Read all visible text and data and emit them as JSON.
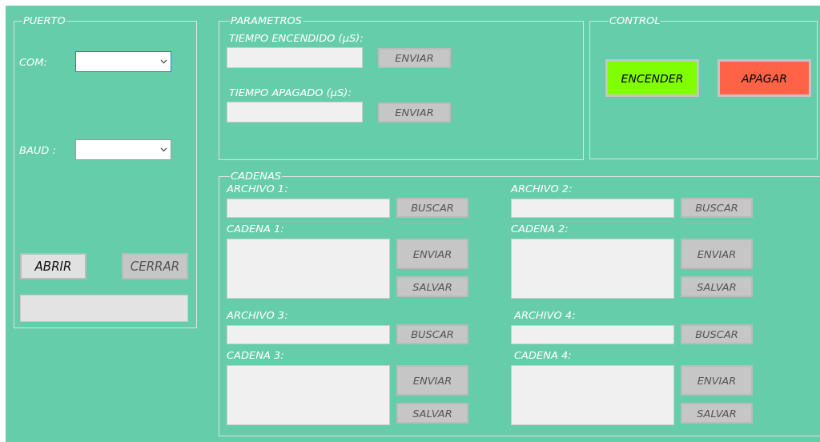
{
  "puerto": {
    "title": "PUERTO",
    "fields": [
      {
        "label": "COM:",
        "focused": true
      },
      {
        "label": "BAUD :",
        "focused": false
      }
    ],
    "buttons": [
      {
        "label": "ABRIR",
        "disabled": false
      },
      {
        "label": "CERRAR",
        "disabled": true
      }
    ]
  },
  "parametros": {
    "title": "PARAMETROS",
    "rows": [
      {
        "label": "TIEMPO ENCENDIDO (µS):",
        "button": {
          "label": "ENVIAR",
          "disabled": true
        }
      },
      {
        "label": "TIEMPO APAGADO (µS):",
        "button": {
          "label": "ENVIAR",
          "disabled": true
        }
      }
    ]
  },
  "control": {
    "title": "CONTROL",
    "buttons": [
      {
        "label": "ENCENDER",
        "color": "#80ff00"
      },
      {
        "label": "APAGAR",
        "color": "#ff6347"
      }
    ]
  },
  "cadenas": {
    "title": "CADENAS",
    "items": [
      {
        "archivo_label": "ARCHIVO 1:",
        "buscar": {
          "label": "BUSCAR",
          "disabled": true
        },
        "cadena_label": "CADENA 1:",
        "enviar": {
          "label": "ENVIAR",
          "disabled": true
        },
        "salvar": {
          "label": "SALVAR",
          "disabled": true
        }
      },
      {
        "archivo_label": "ARCHIVO 2:",
        "buscar": {
          "label": "BUSCAR",
          "disabled": true
        },
        "cadena_label": "CADENA 2:",
        "enviar": {
          "label": "ENVIAR",
          "disabled": true
        },
        "salvar": {
          "label": "SALVAR",
          "disabled": true
        }
      },
      {
        "archivo_label": "ARCHIVO 3:",
        "buscar": {
          "label": "BUSCAR",
          "disabled": true
        },
        "cadena_label": "CADENA 3:",
        "enviar": {
          "label": "ENVIAR",
          "disabled": true
        },
        "salvar": {
          "label": "SALVAR",
          "disabled": true
        }
      },
      {
        "archivo_label": "ARCHIVO 4:",
        "buscar": {
          "label": "BUSCAR",
          "disabled": true
        },
        "cadena_label": "CADENA 4:",
        "enviar": {
          "label": "ENVIAR",
          "disabled": true
        },
        "salvar": {
          "label": "SALVAR",
          "disabled": true
        }
      }
    ]
  }
}
